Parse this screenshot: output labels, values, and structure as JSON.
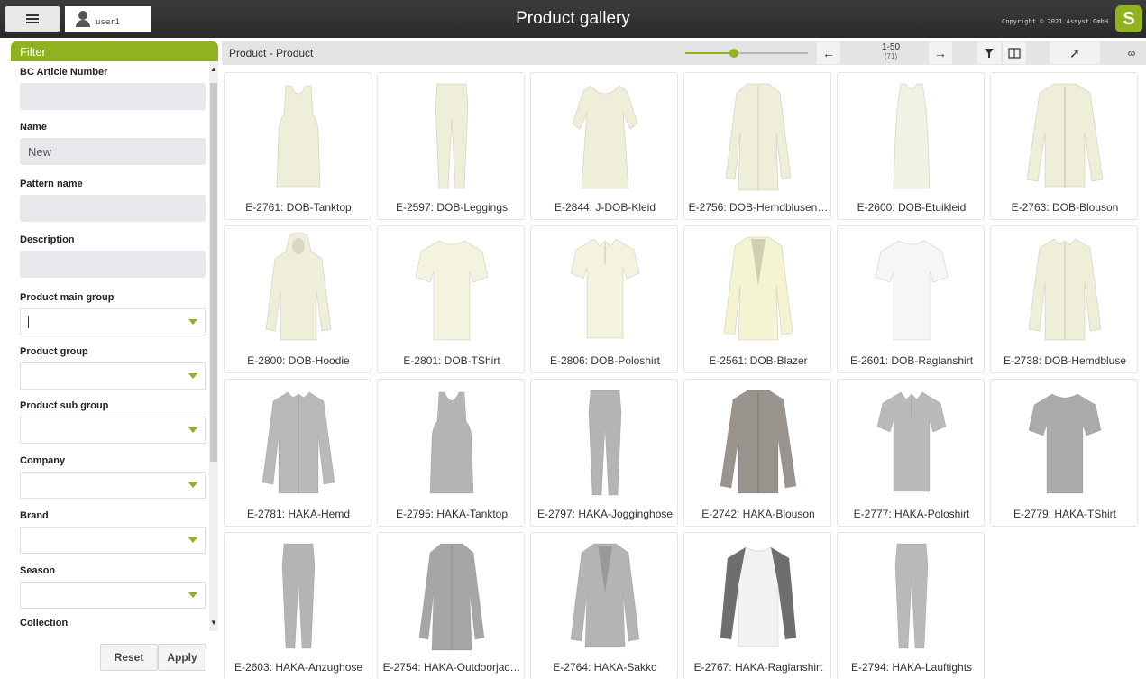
{
  "header": {
    "user_name": "user1",
    "title": "Product gallery",
    "copyright": "Copyright © 2021 Assyst GmbH",
    "logo_letter": "S",
    "accent_color": "#8fb21e"
  },
  "filter": {
    "title": "Filter",
    "fields": [
      {
        "label": "BC Article Number",
        "type": "text",
        "value": ""
      },
      {
        "label": "Name",
        "type": "text",
        "value": "New"
      },
      {
        "label": "Pattern name",
        "type": "text",
        "value": ""
      },
      {
        "label": "Description",
        "type": "text",
        "value": ""
      },
      {
        "label": "Product main group",
        "type": "select",
        "value": ""
      },
      {
        "label": "Product group",
        "type": "select",
        "value": ""
      },
      {
        "label": "Product sub group",
        "type": "select",
        "value": ""
      },
      {
        "label": "Company",
        "type": "select",
        "value": ""
      },
      {
        "label": "Brand",
        "type": "select",
        "value": ""
      },
      {
        "label": "Season",
        "type": "select",
        "value": ""
      },
      {
        "label": "Collection",
        "type": "select",
        "value": ""
      }
    ],
    "reset_label": "Reset",
    "apply_label": "Apply"
  },
  "toolbar": {
    "breadcrumb": "Product - Product",
    "zoom_level": 0.4,
    "page_range": "1-50",
    "total": "(71)",
    "icons": [
      "arrow-left-icon",
      "arrow-right-icon",
      "funnel-icon",
      "columns-icon",
      "share-icon",
      "infinity-icon"
    ]
  },
  "products": [
    {
      "label": "E-2761: DOB-Tanktop",
      "kind": "tank",
      "color": "#efefd9"
    },
    {
      "label": "E-2597: DOB-Leggings",
      "kind": "leggings",
      "color": "#efefd9"
    },
    {
      "label": "E-2844: J-DOB-Kleid",
      "kind": "dress",
      "color": "#efefd9"
    },
    {
      "label": "E-2756: DOB-Hemdblusen…",
      "kind": "coat",
      "color": "#efefd9"
    },
    {
      "label": "E-2600: DOB-Etuikleid",
      "kind": "sheath",
      "color": "#f2f2e2"
    },
    {
      "label": "E-2763: DOB-Blouson",
      "kind": "jacket",
      "color": "#efefd9"
    },
    {
      "label": "E-2800: DOB-Hoodie",
      "kind": "hoodie",
      "color": "#efefd9"
    },
    {
      "label": "E-2801: DOB-TShirt",
      "kind": "tshirt",
      "color": "#f3f3df"
    },
    {
      "label": "E-2806: DOB-Poloshirt",
      "kind": "polo",
      "color": "#f3f3df"
    },
    {
      "label": "E-2561: DOB-Blazer",
      "kind": "blazer",
      "color": "#f4f4d2"
    },
    {
      "label": "E-2601: DOB-Raglanshirt",
      "kind": "tshirt",
      "color": "#f6f6f4"
    },
    {
      "label": "E-2738: DOB-Hemdbluse",
      "kind": "shirt",
      "color": "#efefd9"
    },
    {
      "label": "E-2781: HAKA-Hemd",
      "kind": "shirt",
      "color": "#b9b9b9"
    },
    {
      "label": "E-2795: HAKA-Tanktop",
      "kind": "tank",
      "color": "#b4b4b4"
    },
    {
      "label": "E-2797: HAKA-Jogginghose",
      "kind": "leggings",
      "color": "#b4b4b4"
    },
    {
      "label": "E-2742: HAKA-Blouson",
      "kind": "jacket",
      "color": "#9a948e"
    },
    {
      "label": "E-2777: HAKA-Poloshirt",
      "kind": "polo",
      "color": "#b9b9b9"
    },
    {
      "label": "E-2779: HAKA-TShirt",
      "kind": "tshirt",
      "color": "#ababab"
    },
    {
      "label": "E-2603: HAKA-Anzughose",
      "kind": "leggings",
      "color": "#b4b4b4"
    },
    {
      "label": "E-2754: HAKA-Outdoorjac…",
      "kind": "coat",
      "color": "#a6a6a6"
    },
    {
      "label": "E-2764: HAKA-Sakko",
      "kind": "blazer",
      "color": "#b4b4b4"
    },
    {
      "label": "E-2767: HAKA-Raglanshirt",
      "kind": "raglan",
      "color": "#f2f2f2"
    },
    {
      "label": "E-2794: HAKA-Lauftights",
      "kind": "leggings",
      "color": "#b9b9b9"
    }
  ]
}
